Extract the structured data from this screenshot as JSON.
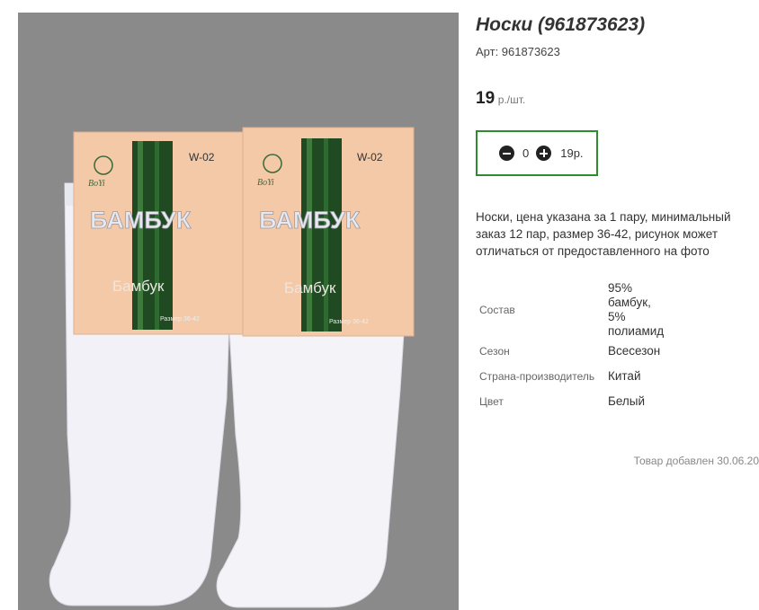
{
  "product": {
    "title": "Носки (961873623)",
    "sku": "Арт: 961873623",
    "price_value": "19",
    "price_unit": "р./шт.",
    "quantity": "0",
    "total": "19р.",
    "description": "Носки, цена указана за 1 пару, минимальный заказ 12 пар, размер 36-42, рисунок может отличаться от предоставленного на фото",
    "props": [
      {
        "key": "Состав",
        "value": "95% бамбук, 5% полиамид"
      },
      {
        "key": "Сезон",
        "value": "Всесезон"
      },
      {
        "key": "Страна-производитель",
        "value": "Китай"
      },
      {
        "key": "Цвет",
        "value": "Белый"
      }
    ],
    "added": "Товар добавлен 30.06.20"
  },
  "photo": {
    "label_code": "W-02",
    "brand": "BoYi",
    "label_title": "БАМБУК",
    "label_subtitle": "Бамбук",
    "label_size": "Размер 36-42"
  },
  "icons": {
    "minus": "minus-circle-icon",
    "plus": "plus-circle-icon"
  },
  "colors": {
    "accent_border": "#2e8b2e",
    "photo_bg": "#8a8a8a"
  }
}
